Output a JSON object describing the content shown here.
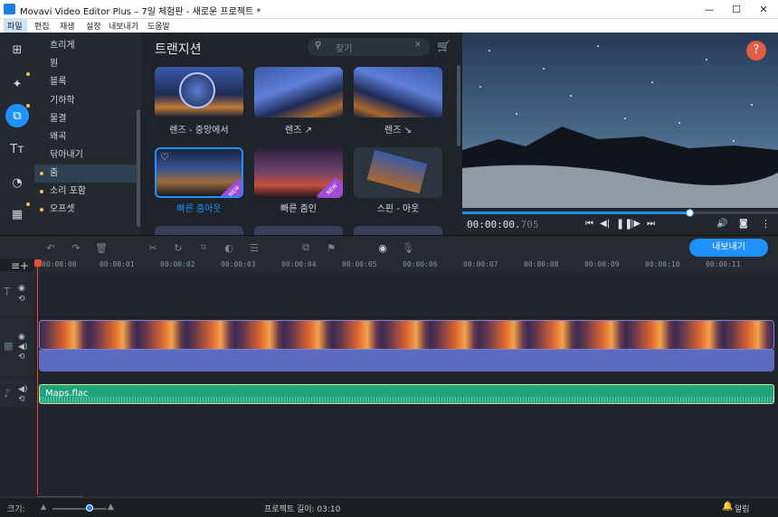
{
  "window": {
    "title": "Movavi Video Editor Plus – 7일 체험판 - 새로운 프로젝트 *",
    "min": "—",
    "max": "☐",
    "close": "✕"
  },
  "menu": [
    "파일",
    "편집",
    "재생",
    "설정",
    "내보내기",
    "도움말"
  ],
  "categories": [
    "흐리게",
    "원",
    "블록",
    "기하학",
    "물결",
    "왜곡",
    "닦아내기",
    "줌",
    "소리 포함",
    "오프셋"
  ],
  "category_dots": [
    false,
    false,
    false,
    false,
    false,
    false,
    false,
    true,
    true,
    true
  ],
  "selected_category": "줌",
  "panel": {
    "title": "트랜지션",
    "search_placeholder": "찾기"
  },
  "transitions": [
    {
      "label": "렌즈 - 중앙에서",
      "badge": ""
    },
    {
      "label": "렌즈 ↗",
      "badge": ""
    },
    {
      "label": "렌즈 ↘",
      "badge": ""
    },
    {
      "label": "빠른 줌아웃",
      "badge": "NEW",
      "selected": true
    },
    {
      "label": "빠른 줌인",
      "badge": "NEW"
    },
    {
      "label": "스핀 - 아웃",
      "badge": ""
    }
  ],
  "player": {
    "time_main": "00:00:00.",
    "time_ms": "705",
    "progress": 0.72,
    "help": "?"
  },
  "export_label": "내보내기",
  "ruler": [
    "00:00:00",
    "00:00:01",
    "00:00:02",
    "00:00:03",
    "00:00:04",
    "00:00:05",
    "00:00:06",
    "00:00:07",
    "00:00:08",
    "00:00:09",
    "00:00:10",
    "00:00:11"
  ],
  "audio_clip": "Maps.flac",
  "status": {
    "scale_label": "크기:",
    "project_length": "프로젝트 길이:  03:10",
    "notifications": "알림"
  },
  "colors": {
    "accent": "#1e90ff",
    "audio": "#1fa37d",
    "video_band": "#5c6bc0",
    "playhead": "#e84a3c"
  }
}
